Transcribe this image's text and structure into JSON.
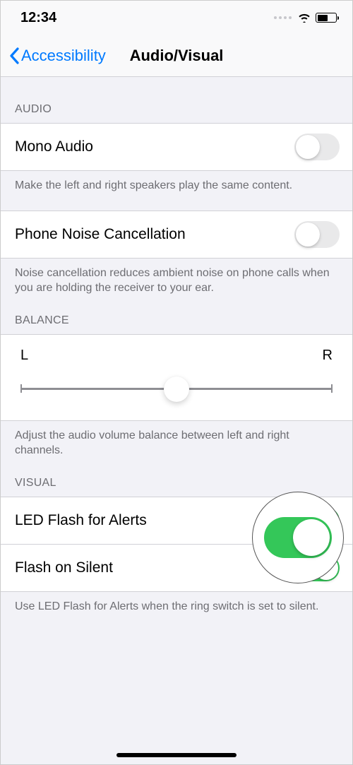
{
  "statusBar": {
    "time": "12:34"
  },
  "nav": {
    "back": "Accessibility",
    "title": "Audio/Visual"
  },
  "audio": {
    "header": "Audio",
    "monoAudio": {
      "label": "Mono Audio",
      "on": false
    },
    "monoFooter": "Make the left and right speakers play the same content.",
    "noiseCancel": {
      "label": "Phone Noise Cancellation",
      "on": false
    },
    "noiseFooter": "Noise cancellation reduces ambient noise on phone calls when you are holding the receiver to your ear."
  },
  "balance": {
    "header": "Balance",
    "left": "L",
    "right": "R",
    "value": 0.5,
    "footer": "Adjust the audio volume balance between left and right channels."
  },
  "visual": {
    "header": "Visual",
    "ledFlash": {
      "label": "LED Flash for Alerts",
      "on": true
    },
    "flashSilent": {
      "label": "Flash on Silent",
      "on": true
    },
    "footer": "Use LED Flash for Alerts when the ring switch is set to silent."
  }
}
